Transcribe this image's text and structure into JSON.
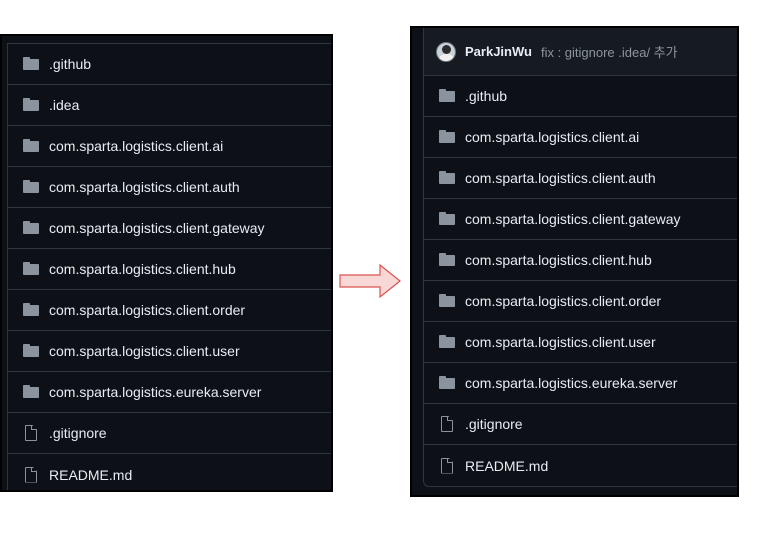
{
  "left_panel": {
    "items": [
      {
        "type": "folder",
        "name": ".github"
      },
      {
        "type": "folder",
        "name": ".idea"
      },
      {
        "type": "folder",
        "name": "com.sparta.logistics.client.ai"
      },
      {
        "type": "folder",
        "name": "com.sparta.logistics.client.auth"
      },
      {
        "type": "folder",
        "name": "com.sparta.logistics.client.gateway"
      },
      {
        "type": "folder",
        "name": "com.sparta.logistics.client.hub"
      },
      {
        "type": "folder",
        "name": "com.sparta.logistics.client.order"
      },
      {
        "type": "folder",
        "name": "com.sparta.logistics.client.user"
      },
      {
        "type": "folder",
        "name": "com.sparta.logistics.eureka.server"
      },
      {
        "type": "file",
        "name": ".gitignore"
      },
      {
        "type": "file",
        "name": "README.md"
      }
    ]
  },
  "arrow": {
    "icon": "arrow-right-icon",
    "fill": "#f8d7d7",
    "stroke": "#d9534f"
  },
  "right_panel": {
    "commit": {
      "author": "ParkJinWu",
      "message": "fix : gitignore .idea/ 추가",
      "avatar_icon": "avatar-icon"
    },
    "items": [
      {
        "type": "folder",
        "name": ".github"
      },
      {
        "type": "folder",
        "name": "com.sparta.logistics.client.ai"
      },
      {
        "type": "folder",
        "name": "com.sparta.logistics.client.auth"
      },
      {
        "type": "folder",
        "name": "com.sparta.logistics.client.gateway"
      },
      {
        "type": "folder",
        "name": "com.sparta.logistics.client.hub"
      },
      {
        "type": "folder",
        "name": "com.sparta.logistics.client.order"
      },
      {
        "type": "folder",
        "name": "com.sparta.logistics.client.user"
      },
      {
        "type": "folder",
        "name": "com.sparta.logistics.eureka.server"
      },
      {
        "type": "file",
        "name": ".gitignore"
      },
      {
        "type": "file",
        "name": "README.md"
      }
    ]
  },
  "colors": {
    "background": "#0d1117",
    "border": "#30363d",
    "text": "#e6edf3",
    "muted": "#8b949e"
  }
}
